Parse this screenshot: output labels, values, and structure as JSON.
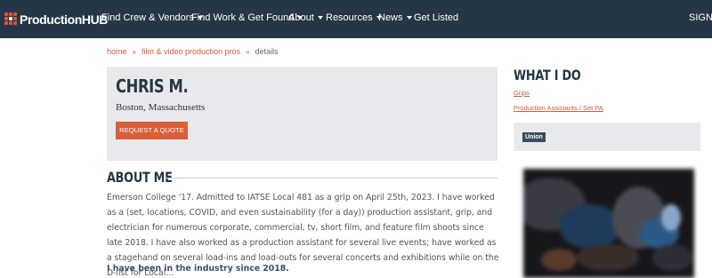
{
  "nav": {
    "logo": "ProductionHUB",
    "items": [
      {
        "label": "Find Crew & Vendors",
        "dropdown": true
      },
      {
        "label": "Find Work & Get Found",
        "dropdown": true
      },
      {
        "label": "About",
        "dropdown": true
      },
      {
        "label": "Resources",
        "dropdown": true
      },
      {
        "label": "News",
        "dropdown": true
      },
      {
        "label": "Get Listed",
        "dropdown": false
      }
    ],
    "signin": "SIGN I"
  },
  "breadcrumb": {
    "home": "home",
    "section": "film & video production pros",
    "current": "details",
    "separator": "»"
  },
  "profile": {
    "name": "CHRIS M.",
    "location": "Boston, Massachusetts",
    "quote_button": "REQUEST A QUOTE"
  },
  "about": {
    "title": "ABOUT ME",
    "text": "Emerson College '17. Admitted to IATSE Local 481 as a grip on April 25th, 2023. I have worked as a (set, locations, COVID, and even sustainability (for a day)) production assistant, grip, and electrician for numerous corporate, commercial, tv, short film, and feature film shoots since late 2018. I have also worked as a production assistant for several live events; have worked as a stagehand on several load-ins and load-outs for several concerts and exhibitions while on the D-list for Local…",
    "industry_since": "I have been in the industry since 2018."
  },
  "sidebar": {
    "title": "WHAT I DO",
    "links": [
      "Grips",
      "Production Assistants / Set PA"
    ],
    "union_badge": "Union"
  },
  "colors": {
    "nav_bg": "#253746",
    "accent": "#d95f3b",
    "card_bg": "#e8e9ec",
    "heading": "#253746"
  }
}
